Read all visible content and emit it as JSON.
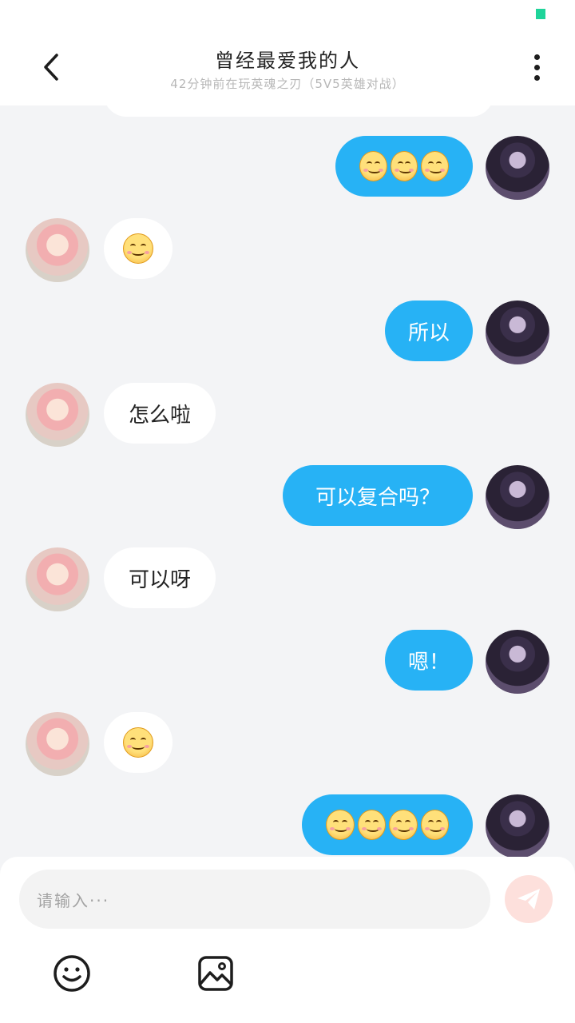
{
  "header": {
    "title": "曾经最爱我的人",
    "subtitle": "42分钟前在玩英魂之刃（5V5英雄对战）"
  },
  "messages": [
    {
      "sender": "me",
      "type": "emoji",
      "count": 3
    },
    {
      "sender": "them",
      "type": "emoji",
      "count": 1
    },
    {
      "sender": "me",
      "type": "text",
      "text": "所以"
    },
    {
      "sender": "them",
      "type": "text",
      "text": "怎么啦"
    },
    {
      "sender": "me",
      "type": "text",
      "text": "可以复合吗？"
    },
    {
      "sender": "them",
      "type": "text",
      "text": "可以呀"
    },
    {
      "sender": "me",
      "type": "text",
      "text": "嗯！"
    },
    {
      "sender": "them",
      "type": "emoji",
      "count": 1
    },
    {
      "sender": "me",
      "type": "emoji",
      "count": 4
    }
  ],
  "composer": {
    "placeholder": "请输入···"
  },
  "icons": {
    "back": "chevron-left-icon",
    "more": "more-vertical-icon",
    "send": "paper-plane-icon",
    "emoji": "smiley-icon",
    "image": "image-icon"
  },
  "colors": {
    "my_bubble": "#27b2f5",
    "their_bubble": "#ffffff",
    "background": "#f3f4f6",
    "send_button": "#fde0dc",
    "status_indicator": "#1fd49a"
  }
}
